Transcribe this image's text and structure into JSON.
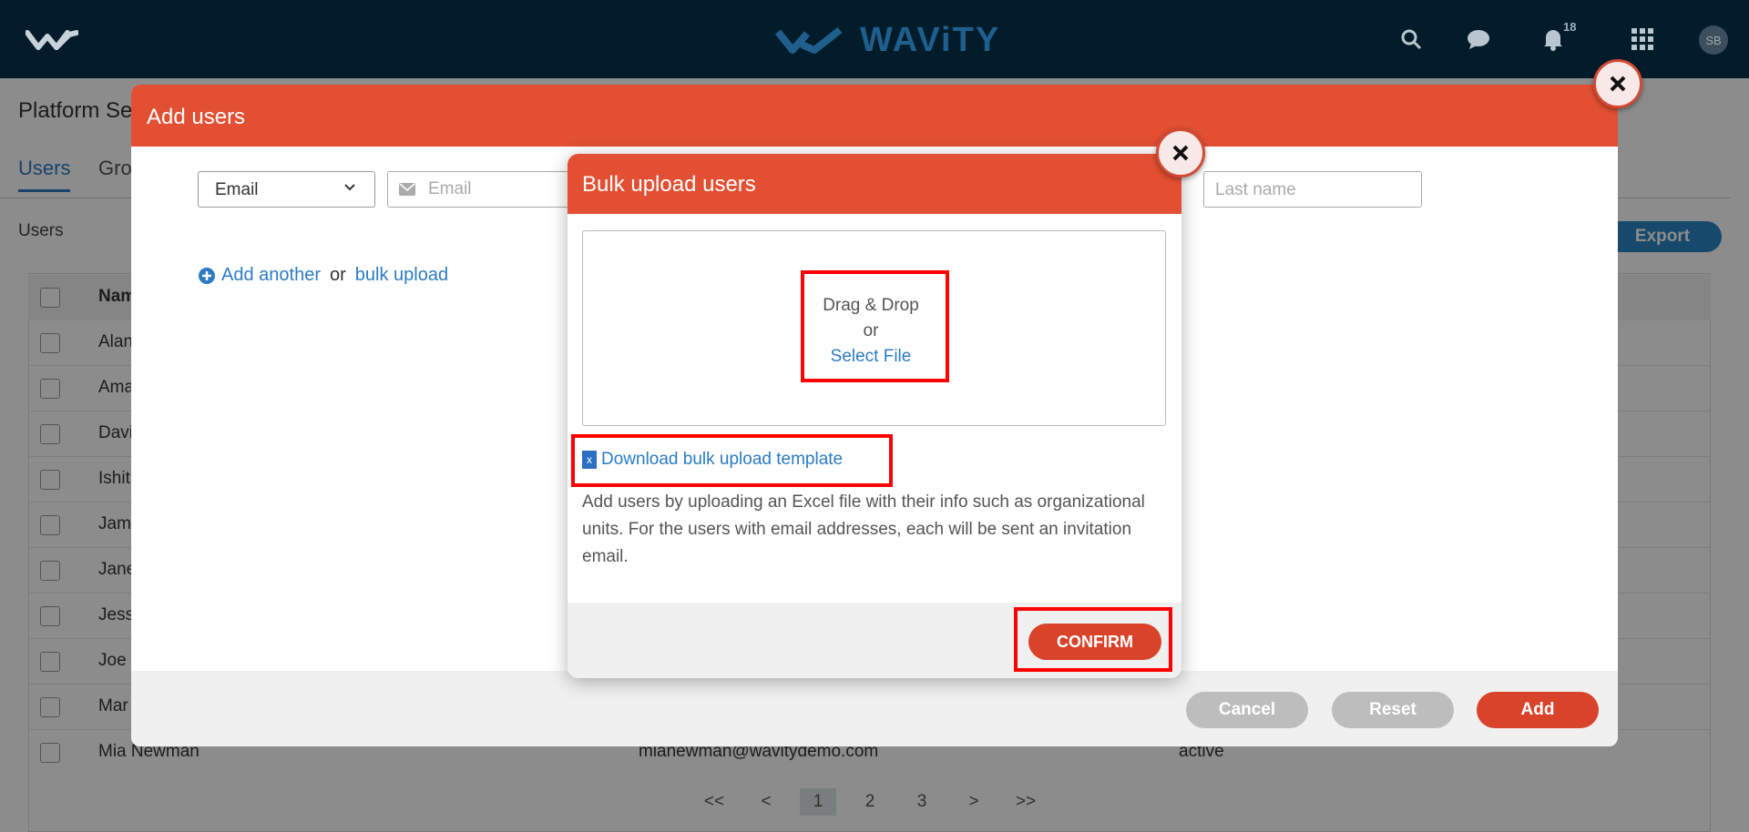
{
  "nav": {
    "brand": "WAViTY",
    "notification_count": "18",
    "avatar_initials": "SB"
  },
  "page": {
    "title": "Platform Se",
    "tabs": [
      "Users",
      "Gro"
    ],
    "users_label": "Users",
    "export_label": "Export",
    "table_header_name": "Nam",
    "rows": [
      {
        "name": "Alan",
        "email": "",
        "status": ""
      },
      {
        "name": "Ama",
        "email": "",
        "status": ""
      },
      {
        "name": "Davi",
        "email": "",
        "status": ""
      },
      {
        "name": "Ishit",
        "email": "",
        "status": ""
      },
      {
        "name": "Jame",
        "email": "",
        "status": ""
      },
      {
        "name": "Jane",
        "email": "",
        "status": ""
      },
      {
        "name": "Jess",
        "email": "",
        "status": ""
      },
      {
        "name": "Joe C",
        "email": "",
        "status": ""
      },
      {
        "name": "Mar",
        "email": "",
        "status": ""
      },
      {
        "name": "Mia Newman",
        "email": "mianewman@wavitydemo.com",
        "status": "active"
      }
    ],
    "pager": [
      "<<",
      "<",
      "1",
      "2",
      "3",
      ">",
      ">>"
    ],
    "pager_active": "1"
  },
  "add_users": {
    "title": "Add users",
    "identifier_select": "Email",
    "email_placeholder": "Email",
    "last_name_placeholder": "Last name",
    "add_another": "Add another",
    "or": "or",
    "bulk_upload": "bulk upload",
    "cancel": "Cancel",
    "reset": "Reset",
    "add": "Add"
  },
  "bulk_upload": {
    "title": "Bulk upload users",
    "drag_drop": "Drag & Drop",
    "or": "or",
    "select_file": "Select File",
    "download_template": "Download bulk upload template",
    "description": "Add users by uploading an Excel file with their info such as organizational units. For the users with email addresses, each will be sent an invitation email.",
    "confirm": "CONFIRM"
  },
  "colors": {
    "nav_bg": "#031c2b",
    "modal_header": "#e24f32",
    "link": "#2b7bc4",
    "primary_button": "#d9432a",
    "highlight": "#ff0000"
  }
}
